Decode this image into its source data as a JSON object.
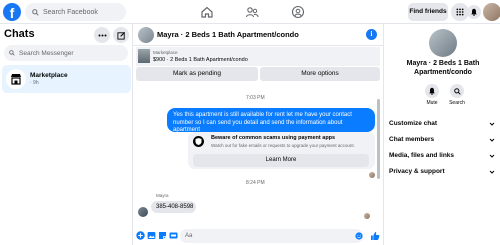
{
  "topbar": {
    "logo": "f",
    "search_placeholder": "Search Facebook",
    "find_friends": "Find friends"
  },
  "sidebar": {
    "title": "Chats",
    "search_placeholder": "Search Messenger",
    "items": [
      {
        "name": "Marketplace",
        "subtitle": "· 9h"
      }
    ]
  },
  "conversation": {
    "title": "Mayra · 2 Beds 1 Bath Apartment/condo",
    "listing": {
      "label": "Marketplace",
      "price_line": "$900 · 2 Beds 1 Bath Apartment/condo"
    },
    "actions": {
      "mark_pending": "Mark as pending",
      "more_options": "More options"
    },
    "time_1": "7:03 PM",
    "outgoing_message": "Yes this apartment is still available for rent let me have your contact number so I can send you detail and send the information about apartment",
    "scam_card": {
      "title": "Beware of common scams using payment apps",
      "body": "Watch out for fake emails or requests to upgrade your payment account.",
      "button": "Learn More"
    },
    "time_2": "8:24 PM",
    "sender_name": "Mayra",
    "incoming_message": "385-408-8598",
    "composer_placeholder": "Aa"
  },
  "right_panel": {
    "title": "Mayra · 2 Beds 1 Bath Apartment/condo",
    "mute_label": "Mute",
    "search_label": "Search",
    "sections": [
      "Customize chat",
      "Chat members",
      "Media, files and links",
      "Privacy & support"
    ]
  },
  "colors": {
    "accent": "#1877f2",
    "bubble": "#0a7cff",
    "bg_gray": "#f0f2f5"
  }
}
